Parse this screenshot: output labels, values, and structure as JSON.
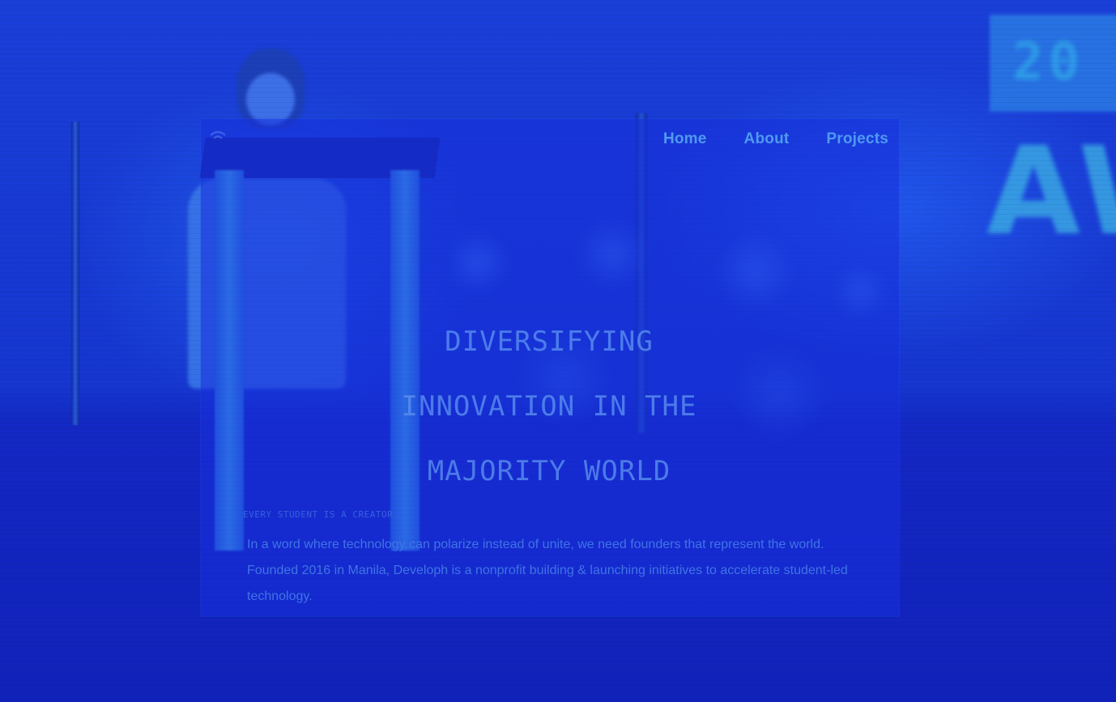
{
  "nav": {
    "items": [
      {
        "label": "Home"
      },
      {
        "label": "About"
      },
      {
        "label": "Projects"
      }
    ]
  },
  "hero": {
    "title_lines": [
      "DIVERSIFYING",
      "INNOVATION IN THE",
      "MAJORITY WORLD"
    ],
    "tagline": "EVERY STUDENT IS A CREATOR",
    "description": "In a word where technology can polarize instead of unite, we need founders that represent the world. Founded 2016 in Manila, Developh is a nonprofit building & launching initiatives to accelerate student-led technology."
  },
  "colors": {
    "background": "#1530c8",
    "nav_link": "#4f9af0",
    "body_text": "#3f74e6",
    "headline": "#5a8ff0"
  },
  "icons": {
    "logo": "wifi-wave-icon"
  }
}
